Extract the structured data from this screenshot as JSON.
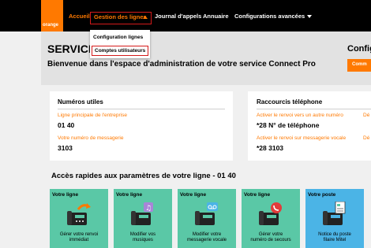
{
  "brand": {
    "logo_text": "orange",
    "accent": "#ff7900",
    "tile_green": "#5ac8a6",
    "tile_blue": "#4bb4e6"
  },
  "nav": {
    "accueil": "Accueil",
    "gestion": "Gestion des lignes",
    "journal": "Journal d'appels",
    "annuaire": "Annuaire",
    "config_avancees": "Configurations avancées"
  },
  "dropdown": {
    "items": [
      "Configuration lignes",
      "Comptes utilisateurs"
    ]
  },
  "banner": {
    "title": "SERVICI",
    "welcome": "Bienvenue dans l'espace d'administration de votre service Connect Pro",
    "config_title": "Config",
    "comm_button": "Comm"
  },
  "numeros": {
    "title": "Numéros utiles",
    "main_line_label": "Ligne principale de l'entreprise",
    "main_line_value": "01 40",
    "voicemail_label": "Votre numéro de messagerie",
    "voicemail_value": "3103"
  },
  "raccourcis": {
    "title": "Raccourcis téléphone",
    "renvoi_label": "Activer le renvoi vers un autre numéro",
    "renvoi_value": "*28 N° de téléphone",
    "renvoi_msg_label": "Activer le renvoi sur messagerie vocale",
    "renvoi_msg_value": "*28 3103",
    "cut_label_1": "Dé",
    "cut_label_2": "Dé"
  },
  "quick_access": {
    "title": "Accès rapides aux paramètres de votre ligne - 01 40",
    "tiles": [
      {
        "caption": "Votre ligne",
        "text": "Gérer votre renvoi\nimmédiat",
        "icon": "phone-forward-icon"
      },
      {
        "caption": "Votre ligne",
        "text": "Modifier vos\nmusiques",
        "icon": "phone-music-icon"
      },
      {
        "caption": "Votre ligne",
        "text": "Modifier votre\nmessagerie vocale",
        "icon": "phone-voicemail-icon"
      },
      {
        "caption": "Votre ligne",
        "text": "Gérer votre\nnuméro de secours",
        "icon": "phone-emergency-icon"
      },
      {
        "caption": "Votre poste",
        "text": "Notice du poste\nfilaire Mitel",
        "icon": "phone-notice-icon"
      }
    ]
  }
}
